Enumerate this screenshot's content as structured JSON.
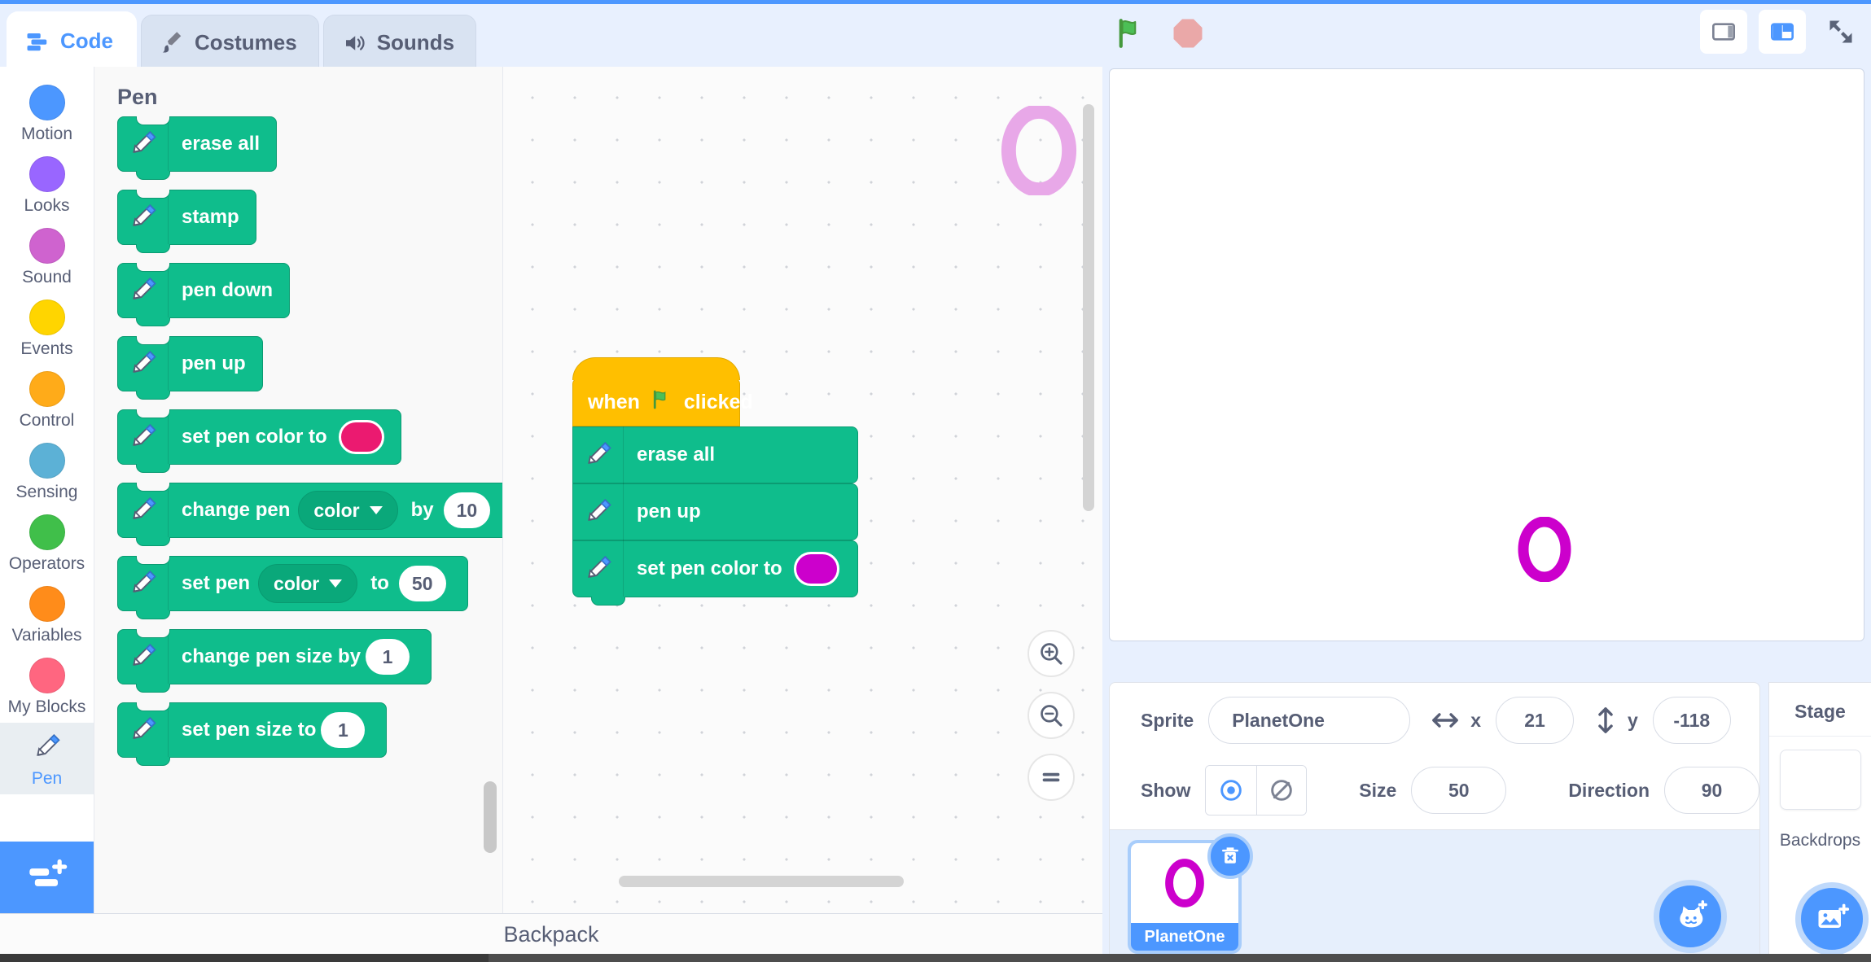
{
  "tabs": [
    {
      "label": "Code",
      "icon": "code-blocks-icon",
      "active": true
    },
    {
      "label": "Costumes",
      "icon": "paintbrush-icon",
      "active": false
    },
    {
      "label": "Sounds",
      "icon": "speaker-icon",
      "active": false
    }
  ],
  "controls": {
    "green_flag": "green-flag-icon",
    "stop": "stop-sign-icon",
    "layout_small": "small-stage-layout-button",
    "layout_normal": "normal-stage-layout-button",
    "layout_full": "fullscreen-button"
  },
  "categories": [
    {
      "label": "Motion",
      "color": "#4c97ff",
      "selected": false
    },
    {
      "label": "Looks",
      "color": "#9966ff",
      "selected": false
    },
    {
      "label": "Sound",
      "color": "#cf63cf",
      "selected": false
    },
    {
      "label": "Events",
      "color": "#ffd500",
      "selected": false
    },
    {
      "label": "Control",
      "color": "#ffab19",
      "selected": false
    },
    {
      "label": "Sensing",
      "color": "#5cb1d6",
      "selected": false
    },
    {
      "label": "Operators",
      "color": "#40bf4a",
      "selected": false
    },
    {
      "label": "Variables",
      "color": "#ff8c1a",
      "selected": false
    },
    {
      "label": "My Blocks",
      "color": "#ff6680",
      "selected": false
    },
    {
      "label": "Pen",
      "color": "#0fbd8c",
      "selected": true
    }
  ],
  "add_extension_label": "add-extension-button",
  "palette": {
    "heading": "Pen",
    "blocks": [
      {
        "kind": "simple",
        "label": "erase all"
      },
      {
        "kind": "simple",
        "label": "stamp"
      },
      {
        "kind": "simple",
        "label": "pen down"
      },
      {
        "kind": "simple",
        "label": "pen up"
      },
      {
        "kind": "color",
        "label": "set pen color to",
        "swatch": "#eb1a70"
      },
      {
        "kind": "dropnum",
        "pre": "change pen",
        "option": "color",
        "mid": "by",
        "value": "10"
      },
      {
        "kind": "dropnum",
        "pre": "set pen",
        "option": "color",
        "mid": "to",
        "value": "50"
      },
      {
        "kind": "num",
        "pre": "change pen size by",
        "value": "1"
      },
      {
        "kind": "num",
        "pre": "set pen size to",
        "value": "1"
      }
    ]
  },
  "script": {
    "hat": {
      "pre": "when",
      "icon": "green-flag-icon",
      "post": "clicked"
    },
    "blocks": [
      {
        "kind": "simple",
        "label": "erase all"
      },
      {
        "kind": "simple",
        "label": "pen up"
      },
      {
        "kind": "color",
        "label": "set pen color to",
        "swatch": "#cc00cc"
      }
    ]
  },
  "workspace": {
    "zoom_in": "zoom-in-button",
    "zoom_out": "zoom-out-button",
    "zoom_reset": "zoom-reset-button",
    "watermark_color": "#e8a8e8"
  },
  "stage": {
    "sprite_color": "#cc00cc"
  },
  "sprite_info": {
    "sprite_label": "Sprite",
    "sprite_name": "PlanetOne",
    "x_label": "x",
    "x_value": "21",
    "y_label": "y",
    "y_value": "-118",
    "show_label": "Show",
    "show_on_icon": "eye-visible-icon",
    "show_off_icon": "eye-hidden-icon",
    "size_label": "Size",
    "size_value": "50",
    "direction_label": "Direction",
    "direction_value": "90"
  },
  "sprite_list": {
    "items": [
      {
        "name": "PlanetOne",
        "selected": true,
        "delete_icon": "trash-delete-icon"
      }
    ],
    "add_sprite_button": "add-sprite-cat-button"
  },
  "stage_panel": {
    "title": "Stage",
    "backdrops_label": "Backdrops",
    "add_backdrop_button": "add-backdrop-button"
  },
  "backpack": {
    "label": "Backpack"
  }
}
